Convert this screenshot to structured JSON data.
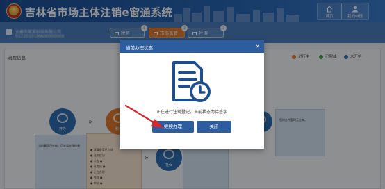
{
  "header": {
    "title": "吉林省市场主体注销e窗通系统",
    "home_label": "首页",
    "user_label": "我的申请"
  },
  "company": {
    "name": "长春市某某科技有限公司",
    "credit_code": "91220101MA0000000X"
  },
  "tabs": [
    {
      "label": "税务",
      "badge": "1"
    },
    {
      "label": "市场监管",
      "badge": "2"
    },
    {
      "label": "社保",
      "badge": "3"
    }
  ],
  "panel": {
    "title": "流程信息",
    "legend": [
      {
        "label": "进行中",
        "color": "#e07a2e"
      },
      {
        "label": "已完成",
        "color": "#3aa34a"
      },
      {
        "label": "未开始",
        "color": "#2f6fb2"
      }
    ]
  },
  "steps": {
    "open_label": "开办",
    "tax_label": "税务",
    "social_label": "社保",
    "open_card_text": "当前事项已办结，可查看办理结果",
    "right_card_text": "您的办件暂时无业务。",
    "tax_rows": [
      "● 清算备案已完成",
      "● 注销登记",
      "● 公告 ●",
      "● 已完成 ●",
      "● 正在办理",
      "● 受理 ●",
      "● 审核 ●",
      "当前正在办理，请耐心等待"
    ]
  },
  "modal": {
    "title": "当前办理状态",
    "close_symbol": "×",
    "message": "正在进行注销登记，当前状态为待签字",
    "continue_label": "继续办理",
    "close_label": "关闭"
  },
  "icons": {
    "modal_icon": "document-clock-icon",
    "pointer": "red-arrow-icon"
  },
  "colors": {
    "header": "#1c4f96",
    "modal_head": "#2d5d9e",
    "active_tab": "#e07a2e",
    "pointer": "#d9262a"
  }
}
